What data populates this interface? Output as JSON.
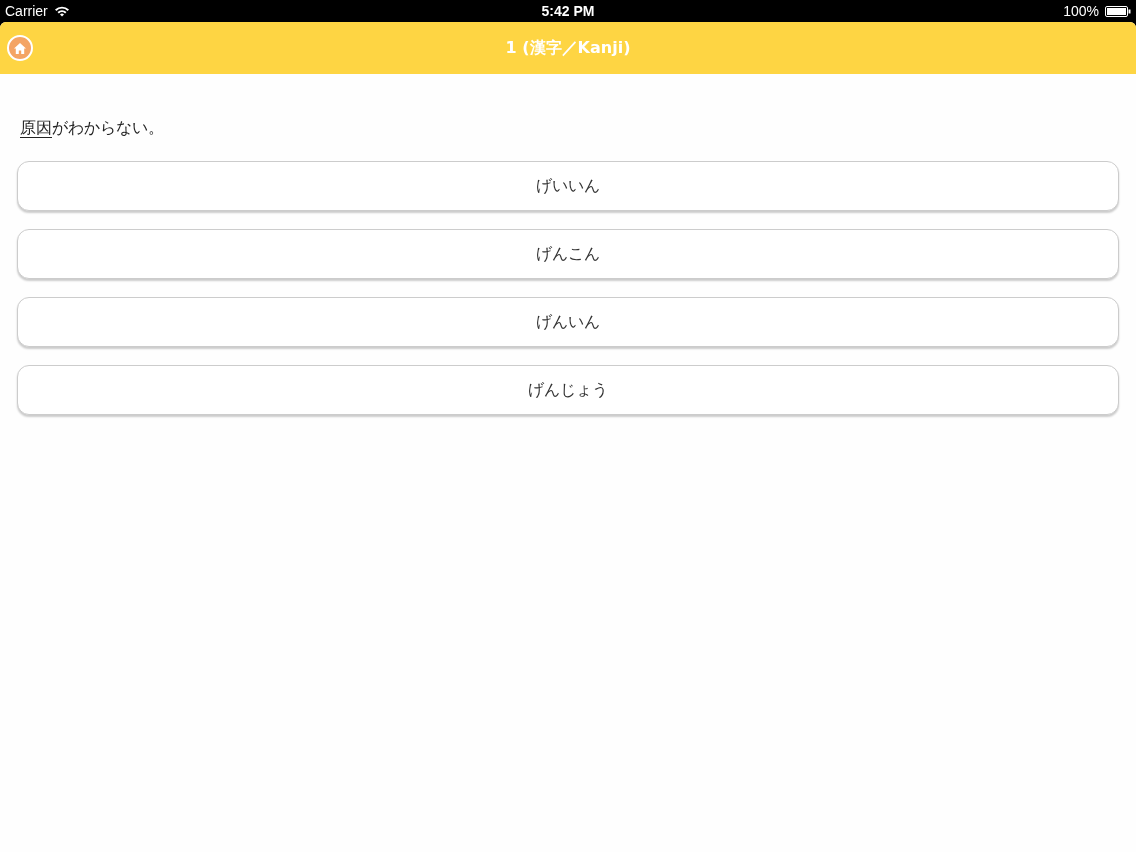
{
  "status_bar": {
    "carrier": "Carrier",
    "time": "5:42 PM",
    "battery": "100%"
  },
  "nav_bar": {
    "title": "1 (漢字／Kanji)"
  },
  "question": {
    "underlined": "原因",
    "rest": "がわからない。"
  },
  "choices": [
    {
      "label": "げいいん"
    },
    {
      "label": "げんこん"
    },
    {
      "label": "げんいん"
    },
    {
      "label": "げんじょう"
    }
  ]
}
